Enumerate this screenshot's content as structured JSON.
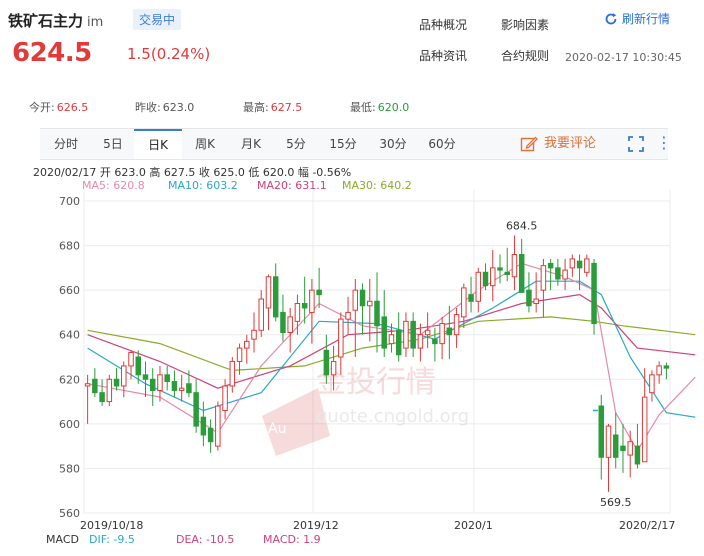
{
  "header": {
    "title": "铁矿石主力",
    "subtitle": "im",
    "status": "交易中",
    "price": "624.5",
    "change": "1.5(0.24%)",
    "links": [
      "品种概况",
      "影响因素",
      "品种资讯",
      "合约规则"
    ],
    "refresh_label": "刷新行情",
    "datetime": "2020-02-17 10:30:45"
  },
  "stats": [
    {
      "label": "今开:",
      "value": "626.5",
      "color": "red"
    },
    {
      "label": "昨收:",
      "value": "623.0",
      "color": "neutral"
    },
    {
      "label": "最高:",
      "value": "627.5",
      "color": "red"
    },
    {
      "label": "最低:",
      "value": "620.0",
      "color": "green"
    }
  ],
  "tabs": [
    "分时",
    "5日",
    "日K",
    "周K",
    "月K",
    "5分",
    "15分",
    "30分",
    "60分"
  ],
  "active_tab": "日K",
  "comment_label": "我要评论",
  "ohlc_line": "2020/02/17  开 623.0  高 627.5  收 625.0  低 620.0  幅 -0.56%",
  "ma_labels": [
    {
      "text": "MA5: 620.8",
      "color": "#e88aa8"
    },
    {
      "text": "MA10: 603.2",
      "color": "#2aa8c8"
    },
    {
      "text": "MA20: 631.1",
      "color": "#d0407a"
    },
    {
      "text": "MA30: 640.2",
      "color": "#8aaa2a"
    }
  ],
  "watermark": {
    "brand": "金投行情",
    "url": "quote.cngold.org",
    "logo_text": "Au"
  },
  "macd": {
    "label": "MACD",
    "dif": "DIF: -9.5",
    "dea": "DEA: -10.5",
    "macd": "MACD: 1.9"
  },
  "chart_data": {
    "type": "candlestick",
    "yticks": [
      "700",
      "680",
      "660",
      "640",
      "620",
      "600",
      "580",
      "560"
    ],
    "ylim": [
      560,
      700
    ],
    "date_labels": [
      "2019/10/18",
      "2019/12",
      "2020/1",
      "2020/2/17"
    ],
    "annotations": [
      {
        "text": "684.5",
        "x_index": 60,
        "y": 684.5
      },
      {
        "text": "569.5",
        "x_index": 73,
        "y": 569.5
      }
    ],
    "colors": {
      "up": "#e03a3a",
      "down": "#2a9c3a"
    },
    "candles": [
      [
        617,
        622,
        600,
        618
      ],
      [
        620,
        625,
        612,
        614
      ],
      [
        614,
        620,
        608,
        610
      ],
      [
        610,
        622,
        608,
        620
      ],
      [
        620,
        625,
        615,
        617
      ],
      [
        617,
        628,
        612,
        626
      ],
      [
        626,
        633,
        620,
        632
      ],
      [
        630,
        633,
        618,
        622
      ],
      [
        622,
        628,
        612,
        620
      ],
      [
        620,
        625,
        608,
        615
      ],
      [
        615,
        626,
        610,
        622
      ],
      [
        622,
        626,
        615,
        619
      ],
      [
        619,
        624,
        612,
        615
      ],
      [
        615,
        622,
        610,
        616
      ],
      [
        618,
        624,
        612,
        614
      ],
      [
        614,
        620,
        596,
        599
      ],
      [
        603,
        610,
        590,
        595
      ],
      [
        598,
        602,
        587,
        592
      ],
      [
        590,
        610,
        588,
        608
      ],
      [
        606,
        620,
        602,
        617
      ],
      [
        617,
        630,
        614,
        628
      ],
      [
        628,
        636,
        622,
        634
      ],
      [
        634,
        640,
        627,
        637
      ],
      [
        638,
        650,
        632,
        642
      ],
      [
        642,
        660,
        639,
        656
      ],
      [
        652,
        667,
        642,
        666
      ],
      [
        666,
        672,
        646,
        648
      ],
      [
        650,
        658,
        637,
        641
      ],
      [
        641,
        652,
        632,
        648
      ],
      [
        646,
        658,
        640,
        654
      ],
      [
        654,
        666,
        645,
        652
      ],
      [
        650,
        665,
        636,
        660
      ],
      [
        660,
        670,
        652,
        658
      ],
      [
        633,
        640,
        618,
        622
      ],
      [
        622,
        635,
        615,
        628
      ],
      [
        630,
        650,
        622,
        647
      ],
      [
        647,
        657,
        640,
        650
      ],
      [
        651,
        665,
        630,
        660
      ],
      [
        660,
        663,
        640,
        653
      ],
      [
        653,
        665,
        637,
        655
      ],
      [
        655,
        668,
        632,
        644
      ],
      [
        648,
        660,
        630,
        634
      ],
      [
        636,
        645,
        632,
        640
      ],
      [
        642,
        650,
        628,
        631
      ],
      [
        634,
        650,
        630,
        646
      ],
      [
        646,
        650,
        630,
        634
      ],
      [
        634,
        645,
        628,
        640
      ],
      [
        640,
        650,
        634,
        642
      ],
      [
        638,
        643,
        628,
        636
      ],
      [
        636,
        648,
        629,
        645
      ],
      [
        643,
        653,
        629,
        640
      ],
      [
        640,
        652,
        634,
        649
      ],
      [
        648,
        663,
        643,
        661
      ],
      [
        658,
        666,
        650,
        655
      ],
      [
        655,
        670,
        650,
        668
      ],
      [
        668,
        672,
        660,
        662
      ],
      [
        662,
        678,
        655,
        670
      ],
      [
        670,
        676,
        663,
        669
      ],
      [
        668,
        679,
        664,
        667
      ],
      [
        666,
        684.5,
        660,
        676
      ],
      [
        676,
        683,
        660,
        659
      ],
      [
        660,
        668,
        650,
        653
      ],
      [
        654,
        668,
        650,
        656
      ],
      [
        660,
        674,
        648,
        671
      ],
      [
        672,
        674,
        660,
        670
      ],
      [
        670,
        674,
        662,
        665
      ],
      [
        665,
        674,
        660,
        669
      ],
      [
        670,
        676,
        666,
        674
      ],
      [
        673,
        676,
        660,
        670
      ],
      [
        668,
        676,
        666,
        674
      ],
      [
        672,
        674,
        640,
        645
      ],
      [
        608,
        613,
        575,
        585
      ],
      [
        585,
        600,
        569.5,
        599
      ],
      [
        595,
        605,
        580,
        585
      ],
      [
        590,
        600,
        578,
        588
      ],
      [
        586,
        597,
        576,
        592
      ],
      [
        590,
        600,
        580,
        582
      ],
      [
        583,
        625,
        583,
        612
      ],
      [
        614,
        624,
        610,
        622
      ],
      [
        622,
        628,
        618,
        626
      ],
      [
        626,
        627.5,
        620,
        625
      ]
    ],
    "ma5": [
      [
        0,
        618
      ],
      [
        10,
        612
      ],
      [
        18,
        596
      ],
      [
        24,
        626
      ],
      [
        32,
        654
      ],
      [
        38,
        644
      ],
      [
        46,
        640
      ],
      [
        54,
        660
      ],
      [
        60,
        672
      ],
      [
        66,
        666
      ],
      [
        70,
        660
      ],
      [
        73,
        605
      ],
      [
        76,
        588
      ],
      [
        79,
        604
      ],
      [
        84,
        621
      ]
    ],
    "ma10": [
      [
        0,
        634
      ],
      [
        8,
        618
      ],
      [
        16,
        606
      ],
      [
        24,
        614
      ],
      [
        32,
        646
      ],
      [
        40,
        645
      ],
      [
        48,
        638
      ],
      [
        56,
        652
      ],
      [
        62,
        664
      ],
      [
        68,
        664
      ],
      [
        71,
        658
      ],
      [
        75,
        630
      ],
      [
        80,
        605
      ],
      [
        84,
        603
      ]
    ],
    "ma20": [
      [
        0,
        640
      ],
      [
        10,
        628
      ],
      [
        18,
        616
      ],
      [
        28,
        626
      ],
      [
        36,
        640
      ],
      [
        44,
        642
      ],
      [
        52,
        646
      ],
      [
        60,
        654
      ],
      [
        68,
        658
      ],
      [
        71,
        652
      ],
      [
        76,
        634
      ],
      [
        84,
        631
      ]
    ],
    "ma30": [
      [
        0,
        642
      ],
      [
        10,
        636
      ],
      [
        20,
        624
      ],
      [
        30,
        626
      ],
      [
        38,
        634
      ],
      [
        46,
        638
      ],
      [
        54,
        646
      ],
      [
        64,
        648
      ],
      [
        70,
        646
      ],
      [
        74,
        644
      ],
      [
        84,
        640
      ]
    ]
  }
}
